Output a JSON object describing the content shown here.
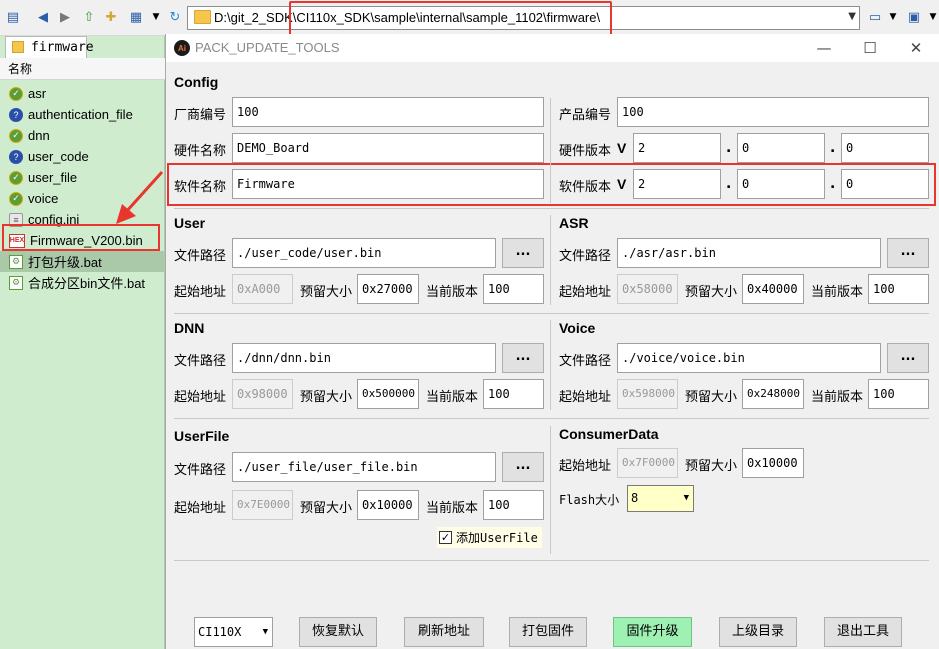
{
  "explorer": {
    "address_path": "D:\\git_2_SDK\\CI110x_SDK\\sample\\internal\\sample_1102\\firmware\\",
    "tab_label": "firmware",
    "column_header": "名称",
    "files": [
      {
        "name": "asr",
        "icon": "svn-folder-check-icon"
      },
      {
        "name": "authentication_file",
        "icon": "svn-folder-question-icon"
      },
      {
        "name": "dnn",
        "icon": "svn-folder-check-icon"
      },
      {
        "name": "user_code",
        "icon": "svn-folder-question-icon"
      },
      {
        "name": "user_file",
        "icon": "svn-folder-check-icon"
      },
      {
        "name": "voice",
        "icon": "svn-folder-check-icon"
      },
      {
        "name": "config.ini",
        "icon": "ini-file-icon"
      },
      {
        "name": "Firmware_V200.bin",
        "icon": "hex-file-icon"
      },
      {
        "name": "打包升级.bat",
        "icon": "bat-file-icon"
      },
      {
        "name": "合成分区bin文件.bat",
        "icon": "bat-file-icon"
      }
    ]
  },
  "dialog": {
    "title": "PACK_UPDATE_TOOLS",
    "app_icon_text": "Ai",
    "config": {
      "section": "Config",
      "vendor_label": "厂商编号",
      "vendor_value": "100",
      "product_label": "产品编号",
      "product_value": "100",
      "hw_name_label": "硬件名称",
      "hw_name_value": "DEMO_Board",
      "hw_ver_label": "硬件版本",
      "hw_ver": [
        "2",
        "0",
        "0"
      ],
      "sw_name_label": "软件名称",
      "sw_name_value": "Firmware",
      "sw_ver_label": "软件版本",
      "sw_ver": [
        "2",
        "0",
        "0"
      ],
      "v_label": "V",
      "dot": "."
    },
    "labels": {
      "path": "文件路径",
      "start_addr": "起始地址",
      "reserve_size": "预留大小",
      "current_ver": "当前版本",
      "browse": "..."
    },
    "user": {
      "section": "User",
      "path": "./user_code/user.bin",
      "start": "0xA000",
      "size": "0x27000",
      "ver": "100"
    },
    "asr": {
      "section": "ASR",
      "path": "./asr/asr.bin",
      "start": "0x58000",
      "size": "0x40000",
      "ver": "100"
    },
    "dnn": {
      "section": "DNN",
      "path": "./dnn/dnn.bin",
      "start": "0x98000",
      "size": "0x500000",
      "ver": "100"
    },
    "voice": {
      "section": "Voice",
      "path": "./voice/voice.bin",
      "start": "0x598000",
      "size": "0x248000",
      "ver": "100"
    },
    "userfile": {
      "section": "UserFile",
      "path": "./user_file/user_file.bin",
      "start": "0x7E0000",
      "size": "0x10000",
      "ver": "100",
      "add_checkbox_label": "添加UserFile",
      "add_checked": true
    },
    "consumer": {
      "section": "ConsumerData",
      "start": "0x7F0000",
      "size": "0x10000",
      "flash_label": "Flash大小",
      "flash_value": "8"
    },
    "buttons": {
      "chip": "CI110X",
      "restore": "恢复默认",
      "refresh": "刷新地址",
      "pack": "打包固件",
      "upgrade": "固件升级",
      "parent": "上级目录",
      "exit": "退出工具"
    }
  },
  "colors": {
    "highlight_red": "#e8352e",
    "upgrade_green": "#9ff0b3",
    "panel_green": "#cfeccf"
  }
}
